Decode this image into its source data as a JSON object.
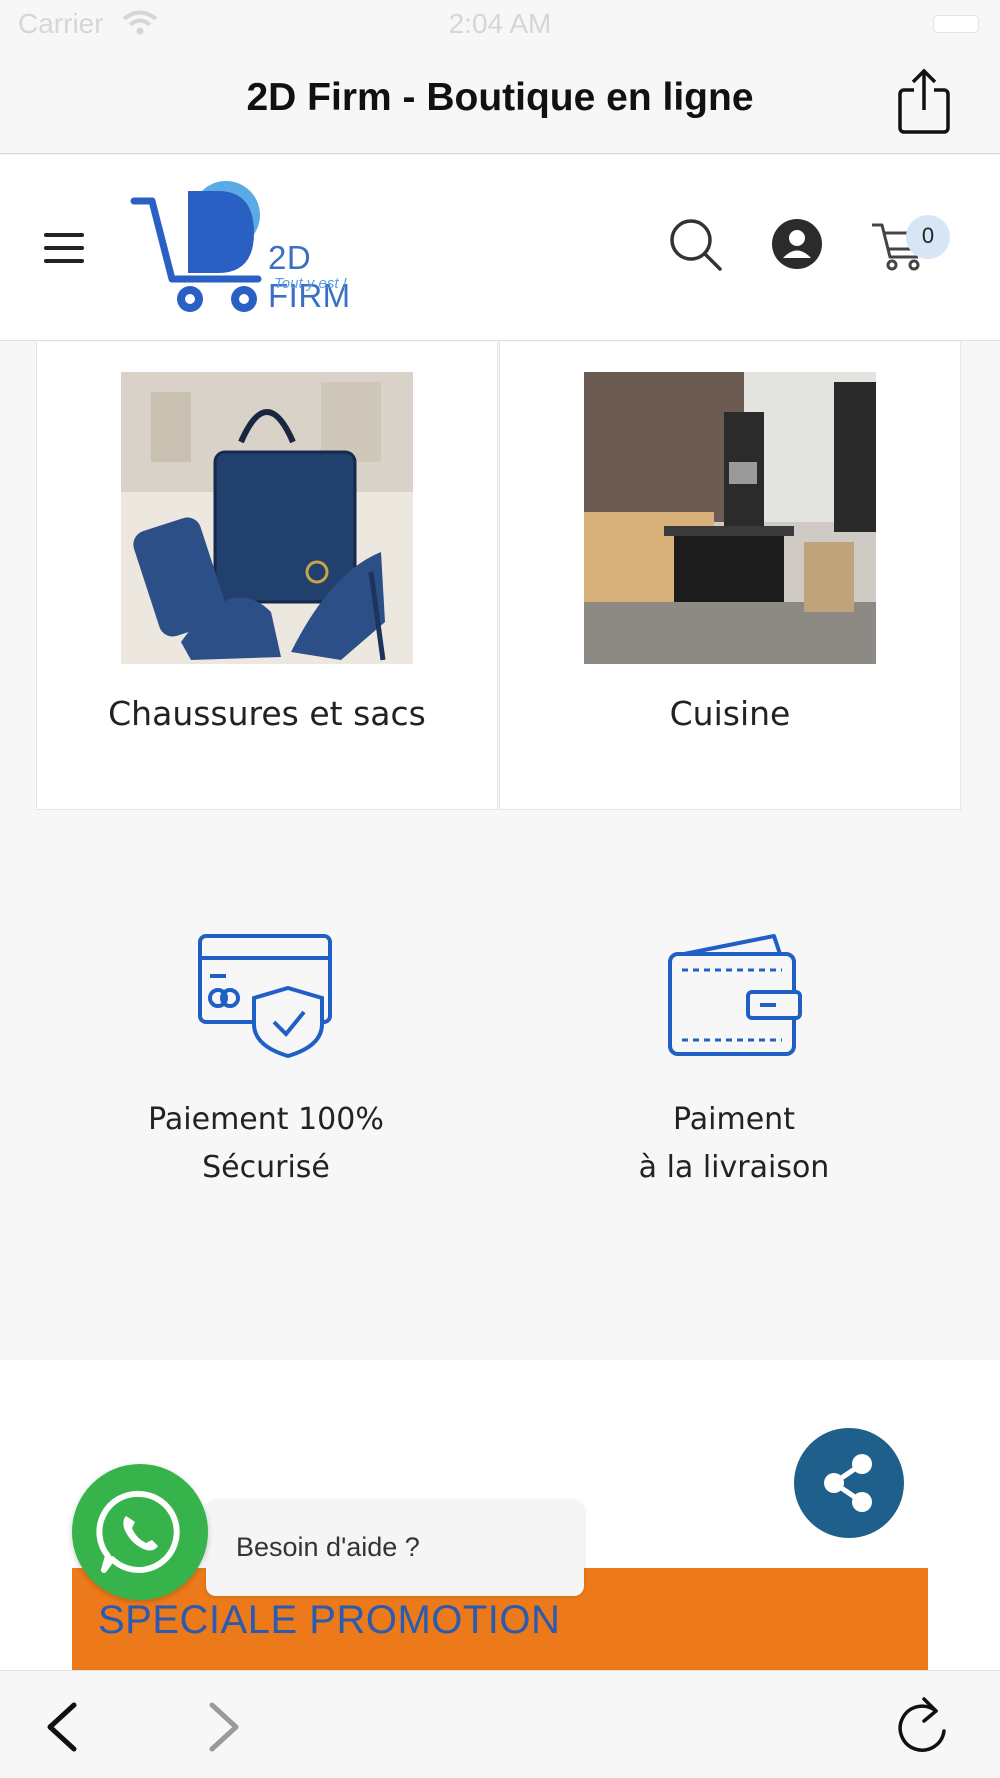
{
  "status_bar": {
    "carrier": "Carrier",
    "time": "2:04 AM"
  },
  "browser": {
    "title": "2D Firm - Boutique en ligne"
  },
  "header": {
    "logo_text": "2D FIRM",
    "logo_tagline": "Tout y est !",
    "cart_count": "0"
  },
  "categories": [
    {
      "label": "Chaussures et sacs"
    },
    {
      "label": "Cuisine"
    }
  ],
  "features": [
    {
      "line1": "Paiement 100%",
      "line2": "Sécurisé"
    },
    {
      "line1": "Paiment",
      "line2": "à la livraison"
    }
  ],
  "promo": {
    "text": "SPECIALE PROMOTION"
  },
  "help": {
    "text": "Besoin d'aide ?"
  },
  "colors": {
    "brand_blue": "#1f5fc6",
    "promo_orange": "#ec7a1a",
    "whatsapp_green": "#36b34b",
    "share_blue": "#1f5f8b"
  }
}
